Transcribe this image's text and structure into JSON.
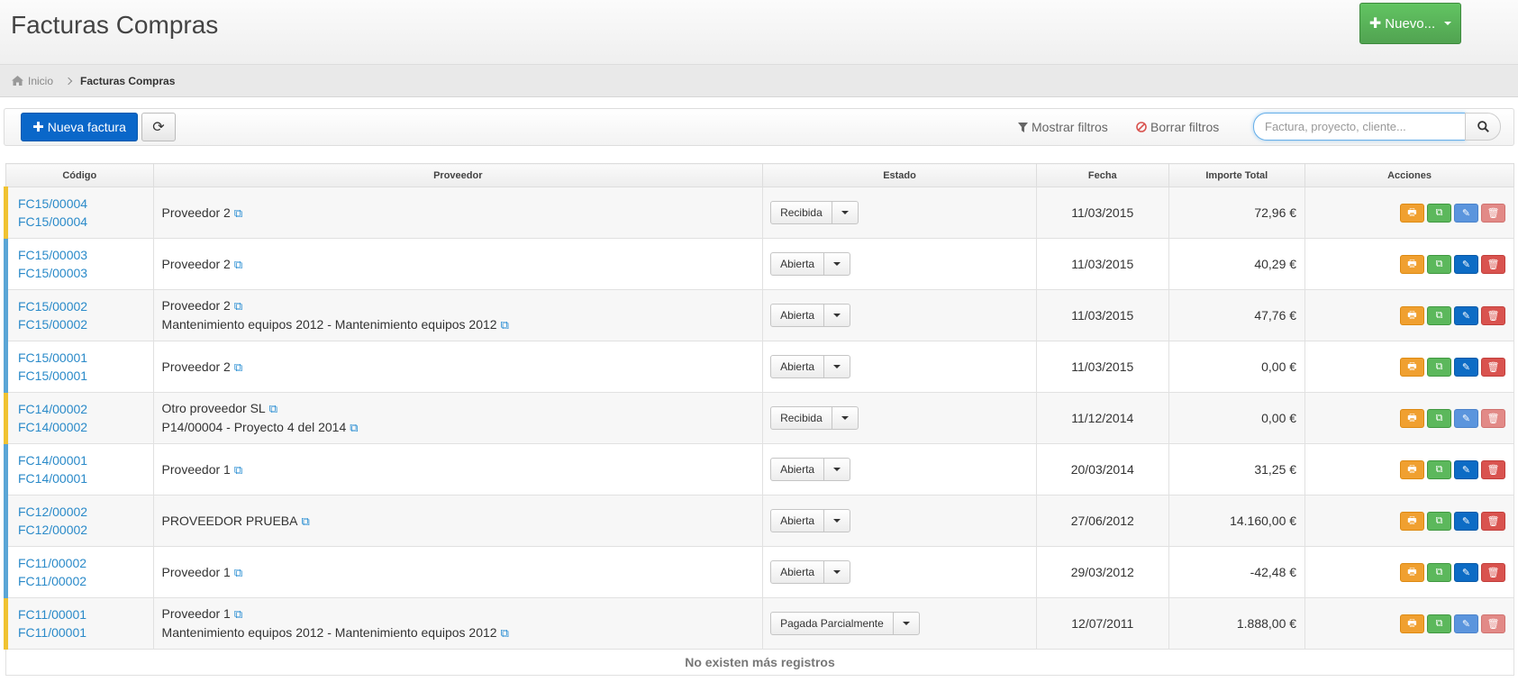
{
  "header": {
    "title": "Facturas Compras",
    "new_button": "Nuevo..."
  },
  "breadcrumb": {
    "home": "Inicio",
    "current": "Facturas Compras"
  },
  "toolbar": {
    "new_invoice": "Nueva factura",
    "show_filters": "Mostrar filtros",
    "clear_filters": "Borrar filtros",
    "search_placeholder": "Factura, proyecto, cliente..."
  },
  "colors": {
    "status_received": "#f0c232",
    "status_open": "#5aa5d6",
    "accent_blue": "#0a67c9",
    "accent_green": "#5cb85c"
  },
  "table": {
    "headers": {
      "codigo": "Código",
      "proveedor": "Proveedor",
      "estado": "Estado",
      "fecha": "Fecha",
      "importe": "Importe Total",
      "acciones": "Acciones"
    },
    "rows": [
      {
        "code1": "FC15/00004",
        "code2": "FC15/00004",
        "prov1": "Proveedor 2",
        "prov2": "",
        "estado": "Recibida",
        "fecha": "11/03/2015",
        "importe": "72,96 €"
      },
      {
        "code1": "FC15/00003",
        "code2": "FC15/00003",
        "prov1": "Proveedor 2",
        "prov2": "",
        "estado": "Abierta",
        "fecha": "11/03/2015",
        "importe": "40,29 €"
      },
      {
        "code1": "FC15/00002",
        "code2": "FC15/00002",
        "prov1": "Proveedor 2",
        "prov2": "Mantenimiento equipos 2012 - Mantenimiento equipos 2012",
        "estado": "Abierta",
        "fecha": "11/03/2015",
        "importe": "47,76 €"
      },
      {
        "code1": "FC15/00001",
        "code2": "FC15/00001",
        "prov1": "Proveedor 2",
        "prov2": "",
        "estado": "Abierta",
        "fecha": "11/03/2015",
        "importe": "0,00 €"
      },
      {
        "code1": "FC14/00002",
        "code2": "FC14/00002",
        "prov1": "Otro proveedor SL",
        "prov2": "P14/00004 - Proyecto 4 del 2014",
        "estado": "Recibida",
        "fecha": "11/12/2014",
        "importe": "0,00 €"
      },
      {
        "code1": "FC14/00001",
        "code2": "FC14/00001",
        "prov1": "Proveedor 1",
        "prov2": "",
        "estado": "Abierta",
        "fecha": "20/03/2014",
        "importe": "31,25 €"
      },
      {
        "code1": "FC12/00002",
        "code2": "FC12/00002",
        "prov1": "PROVEEDOR PRUEBA",
        "prov2": "",
        "estado": "Abierta",
        "fecha": "27/06/2012",
        "importe": "14.160,00 €"
      },
      {
        "code1": "FC11/00002",
        "code2": "FC11/00002",
        "prov1": "Proveedor 1",
        "prov2": "",
        "estado": "Abierta",
        "fecha": "29/03/2012",
        "importe": "-42,48 €"
      },
      {
        "code1": "FC11/00001",
        "code2": "FC11/00001",
        "prov1": "Proveedor 1",
        "prov2": "Mantenimiento equipos 2012 - Mantenimiento equipos 2012",
        "estado": "Pagada Parcialmente",
        "fecha": "12/07/2011",
        "importe": "1.888,00 €"
      }
    ],
    "footer": "No existen más registros"
  }
}
